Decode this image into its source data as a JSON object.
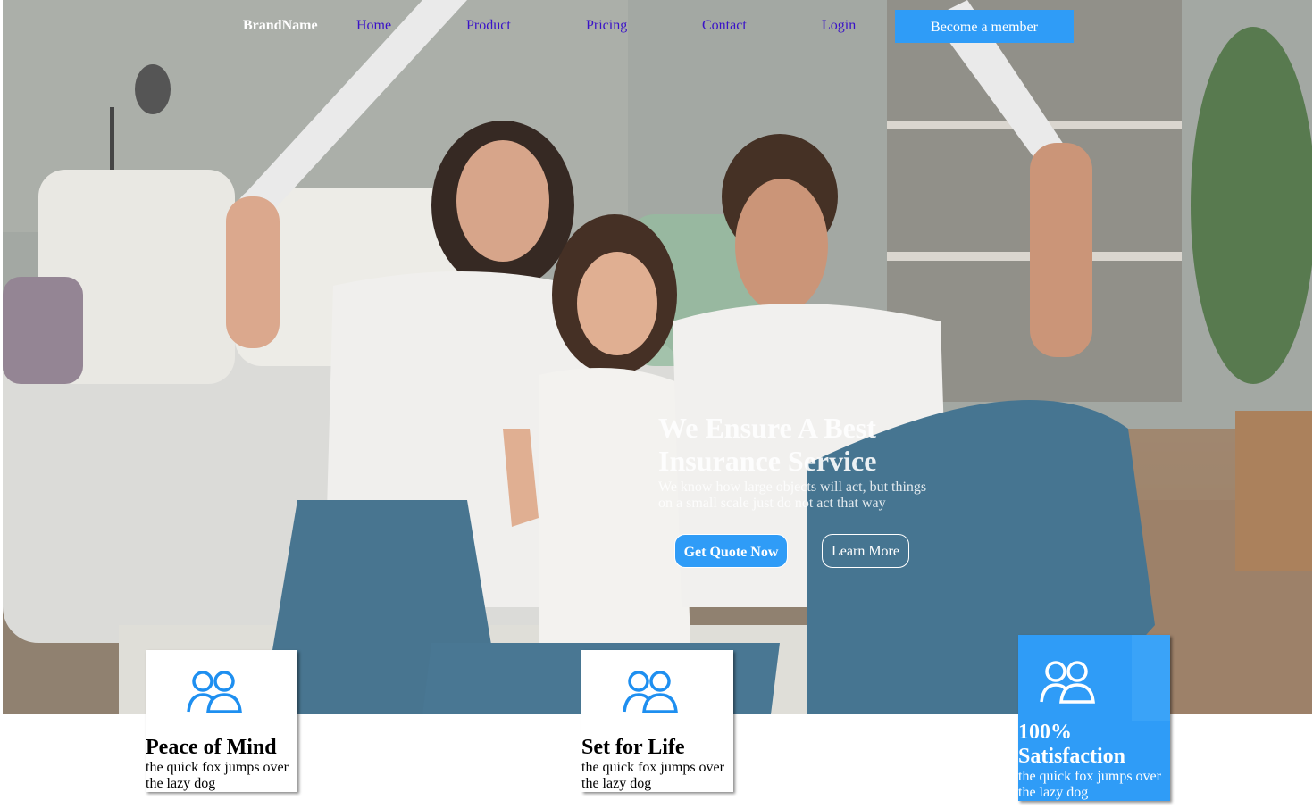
{
  "nav": {
    "brand": "BrandName",
    "links": [
      "Home",
      "Product",
      "Pricing",
      "Contact",
      "Login"
    ],
    "cta": "Become a member",
    "link_color": "#3a12c8"
  },
  "hero": {
    "title": "We Ensure A Best Insurance Service",
    "subtitle": "We know how large objects will act, but things on a small scale just do not act that way",
    "primary_button": "Get Quote Now",
    "secondary_button": "Learn More",
    "background_image": "family-in-living-room-photo"
  },
  "features": [
    {
      "icon": "users-icon",
      "title": "Peace of Mind",
      "text": "the quick fox jumps over the lazy dog",
      "active": false
    },
    {
      "icon": "users-icon",
      "title": "Set for Life",
      "text": "the quick fox jumps over the lazy dog",
      "active": false
    },
    {
      "icon": "users-icon",
      "title": "100% Satisfaction",
      "text": "the quick fox jumps over the lazy dog",
      "active": true
    }
  ],
  "colors": {
    "accent": "#2f9cf7",
    "white": "#ffffff"
  }
}
